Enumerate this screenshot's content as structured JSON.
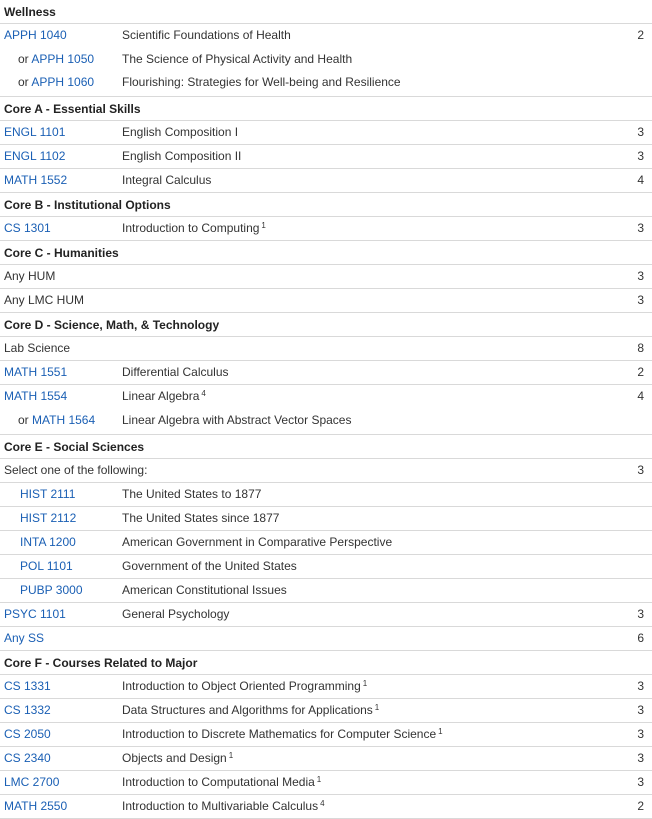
{
  "sections": [
    {
      "header": "Wellness",
      "rows": [
        {
          "lines": [
            {
              "prefix": "",
              "code": "APPH 1040",
              "title": "Scientific Foundations of Health",
              "sup": "",
              "hours": "2"
            },
            {
              "prefix": "or ",
              "code": "APPH 1050",
              "title": "The Science of Physical Activity and Health",
              "sup": "",
              "hours": ""
            },
            {
              "prefix": "or ",
              "code": "APPH 1060",
              "title": "Flourishing: Strategies for Well-being and Resilience",
              "sup": "",
              "hours": ""
            }
          ]
        }
      ]
    },
    {
      "header": "Core A - Essential Skills",
      "rows": [
        {
          "lines": [
            {
              "prefix": "",
              "code": "ENGL 1101",
              "title": "English Composition I",
              "sup": "",
              "hours": "3"
            }
          ]
        },
        {
          "lines": [
            {
              "prefix": "",
              "code": "ENGL 1102",
              "title": "English Composition II",
              "sup": "",
              "hours": "3"
            }
          ]
        },
        {
          "lines": [
            {
              "prefix": "",
              "code": "MATH 1552",
              "title": "Integral Calculus",
              "sup": "",
              "hours": "4"
            }
          ]
        }
      ]
    },
    {
      "header": "Core B - Institutional Options",
      "rows": [
        {
          "lines": [
            {
              "prefix": "",
              "code": "CS 1301",
              "title": "Introduction to Computing",
              "sup": "1",
              "hours": "3"
            }
          ]
        }
      ]
    },
    {
      "header": "Core C - Humanities",
      "rows": [
        {
          "lines": [
            {
              "prefix": "",
              "plain": "Any HUM",
              "title": "",
              "sup": "",
              "hours": "3"
            }
          ]
        },
        {
          "lines": [
            {
              "prefix": "",
              "plain": "Any LMC HUM",
              "title": "",
              "sup": "",
              "hours": "3"
            }
          ]
        }
      ]
    },
    {
      "header": "Core D - Science, Math, & Technology",
      "rows": [
        {
          "lines": [
            {
              "prefix": "",
              "plain": "Lab Science",
              "title": "",
              "sup": "",
              "hours": "8"
            }
          ]
        },
        {
          "lines": [
            {
              "prefix": "",
              "code": "MATH 1551",
              "title": "Differential Calculus",
              "sup": "",
              "hours": "2"
            }
          ]
        },
        {
          "lines": [
            {
              "prefix": "",
              "code": "MATH 1554",
              "title": "Linear Algebra",
              "sup": "4",
              "hours": "4"
            },
            {
              "prefix": "or ",
              "code": "MATH 1564",
              "title": "Linear Algebra with Abstract Vector Spaces",
              "sup": "",
              "hours": ""
            }
          ]
        }
      ]
    },
    {
      "header": "Core E - Social Sciences",
      "rows": [
        {
          "lines": [
            {
              "prefix": "",
              "plain": "Select one of the following:",
              "title": "",
              "sup": "",
              "hours": "3"
            }
          ]
        },
        {
          "lines": [
            {
              "prefix": "",
              "indent": true,
              "code": "HIST 2111",
              "title": "The United States to 1877",
              "sup": "",
              "hours": ""
            }
          ]
        },
        {
          "lines": [
            {
              "prefix": "",
              "indent": true,
              "code": "HIST 2112",
              "title": "The United States since 1877",
              "sup": "",
              "hours": ""
            }
          ]
        },
        {
          "lines": [
            {
              "prefix": "",
              "indent": true,
              "code": "INTA 1200",
              "title": "American Government in Comparative Perspective",
              "sup": "",
              "hours": ""
            }
          ]
        },
        {
          "lines": [
            {
              "prefix": "",
              "indent": true,
              "code": "POL 1101",
              "title": "Government of the United States",
              "sup": "",
              "hours": ""
            }
          ]
        },
        {
          "lines": [
            {
              "prefix": "",
              "indent": true,
              "code": "PUBP 3000",
              "title": "American Constitutional Issues",
              "sup": "",
              "hours": ""
            }
          ]
        },
        {
          "lines": [
            {
              "prefix": "",
              "code": "PSYC 1101",
              "title": "General Psychology",
              "sup": "",
              "hours": "3"
            }
          ]
        },
        {
          "lines": [
            {
              "prefix": "",
              "code": "Any SS",
              "title": "",
              "sup": "",
              "hours": "6"
            }
          ]
        }
      ]
    },
    {
      "header": "Core F - Courses Related to Major",
      "rows": [
        {
          "lines": [
            {
              "prefix": "",
              "code": "CS 1331",
              "title": "Introduction to Object Oriented Programming",
              "sup": "1",
              "hours": "3"
            }
          ]
        },
        {
          "lines": [
            {
              "prefix": "",
              "code": "CS 1332",
              "title": "Data Structures and Algorithms for Applications",
              "sup": "1",
              "hours": "3"
            }
          ]
        },
        {
          "lines": [
            {
              "prefix": "",
              "code": "CS 2050",
              "title": "Introduction to Discrete Mathematics for Computer Science",
              "sup": "1",
              "hours": "3"
            }
          ]
        },
        {
          "lines": [
            {
              "prefix": "",
              "code": "CS 2340",
              "title": "Objects and Design",
              "sup": "1",
              "hours": "3"
            }
          ]
        },
        {
          "lines": [
            {
              "prefix": "",
              "code": "LMC 2700",
              "title": "Introduction to Computational Media",
              "sup": "1",
              "hours": "3"
            }
          ]
        },
        {
          "lines": [
            {
              "prefix": "",
              "code": "MATH 2550",
              "title": "Introduction to Multivariable Calculus",
              "sup": "4",
              "hours": "2"
            }
          ]
        }
      ]
    }
  ]
}
